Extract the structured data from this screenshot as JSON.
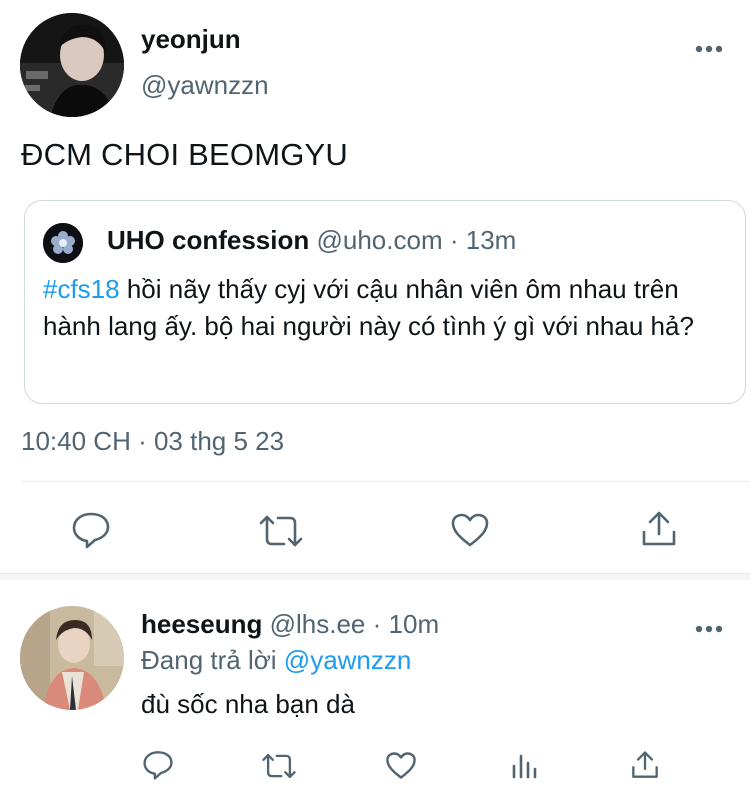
{
  "tweet": {
    "display_name": "yeonjun",
    "handle": "@yawnzzn",
    "text": "ĐCM CHOI BEOMGYU",
    "timestamp": "10:40 CH · 03 thg 5 23"
  },
  "quoted_tweet": {
    "display_name": "UHO confession",
    "handle": "@uho.com",
    "time": "13m",
    "hashtag": "#cfs18",
    "text": "hồi nãy thấy cyj với cậu nhân viên ôm nhau trên hành lang ấy. bộ hai người này có tình ý gì với nhau hả?"
  },
  "reply": {
    "display_name": "heeseung",
    "handle": "@lhs.ee",
    "time": "10m",
    "replying_prefix": "Đang trả lời",
    "replying_to": "@yawnzzn",
    "text": "đù sốc nha bạn dà"
  },
  "icons": {
    "more": "more-horizontal-icon",
    "reply": "comment-icon",
    "retweet": "retweet-icon",
    "like": "heart-icon",
    "share": "share-icon",
    "analytics": "analytics-icon"
  },
  "colors": {
    "accent": "#1d9bf0",
    "text": "#0f1419",
    "muted": "#536471",
    "border": "#cfd9de"
  }
}
